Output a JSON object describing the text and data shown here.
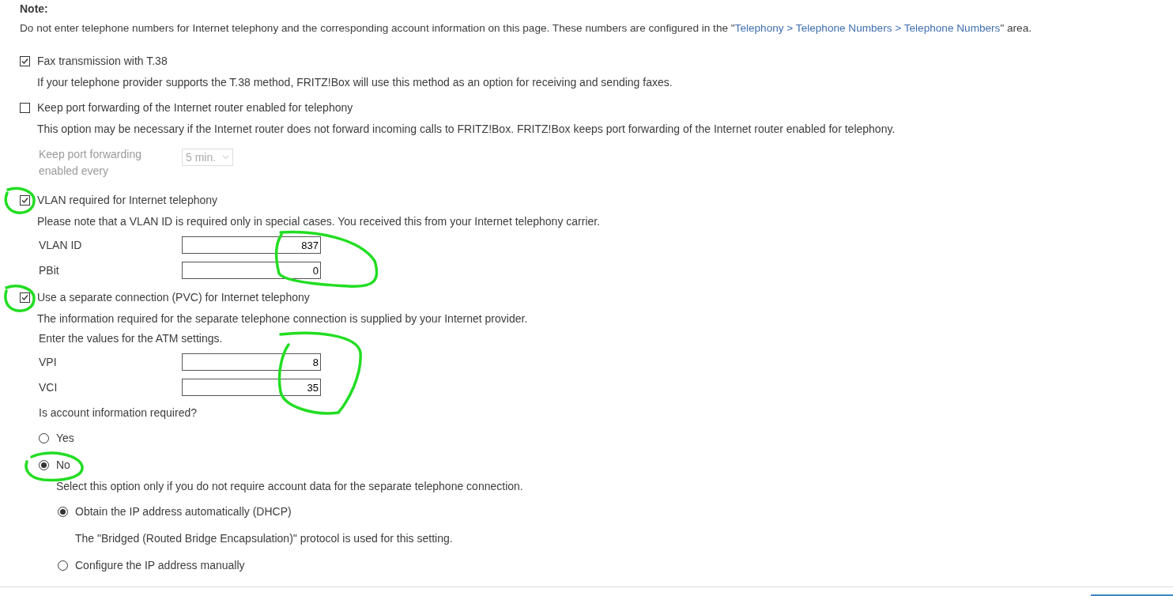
{
  "note": {
    "title": "Note:",
    "text_before": "Do not enter telephone numbers for Internet telephony and the corresponding account information on this page. These numbers are configured in the \"",
    "link": "Telephony > Telephone Numbers > Telephone Numbers",
    "text_after": "\" area."
  },
  "options": [
    {
      "kind": "checkbox",
      "label": "Fax transmission with T.38",
      "checked": true,
      "description": "If your telephone provider supports the T.38 method, FRITZ!Box will use this method as an option for receiving and sending faxes."
    },
    {
      "kind": "checkbox",
      "label": "Keep port forwarding of the Internet router enabled for telephony",
      "checked": false,
      "description": "This option may be necessary if the Internet router does not forward incoming calls to FRITZ!Box. FRITZ!Box keeps port forwarding of the Internet router enabled for telephony.",
      "setting": {
        "label": "Keep port forwarding enabled every",
        "value": "5 min.",
        "disabled": true
      }
    },
    {
      "kind": "checkbox",
      "label": "VLAN required for Internet telephony",
      "checked": true,
      "description": "Please note that a VLAN ID is required only in special cases. You received this from your Internet telephony carrier.",
      "fields": [
        {
          "label": "VLAN ID",
          "value": "837"
        },
        {
          "label": "PBit",
          "value": "0"
        }
      ]
    },
    {
      "kind": "checkbox",
      "label": "Use a separate connection (PVC) for Internet telephony",
      "checked": true,
      "description": "The information required for the separate telephone connection is supplied by your Internet provider.",
      "intro": "Enter the values for the ATM settings.",
      "fields": [
        {
          "label": "VPI",
          "value": "8"
        },
        {
          "label": "VCI",
          "value": "35"
        }
      ],
      "question": "Is account information required?",
      "radios": [
        {
          "label": "Yes",
          "selected": false
        },
        {
          "label": "No",
          "selected": true,
          "description": "Select this option only if you do not require account data for the separate telephone connection.",
          "children": [
            {
              "label": "Obtain the IP address automatically (DHCP)",
              "selected": true,
              "description": "The \"Bridged (Routed Bridge Encapsulation)\" protocol is used for this setting."
            },
            {
              "label": "Configure the IP address manually",
              "selected": false
            }
          ]
        }
      ]
    }
  ]
}
